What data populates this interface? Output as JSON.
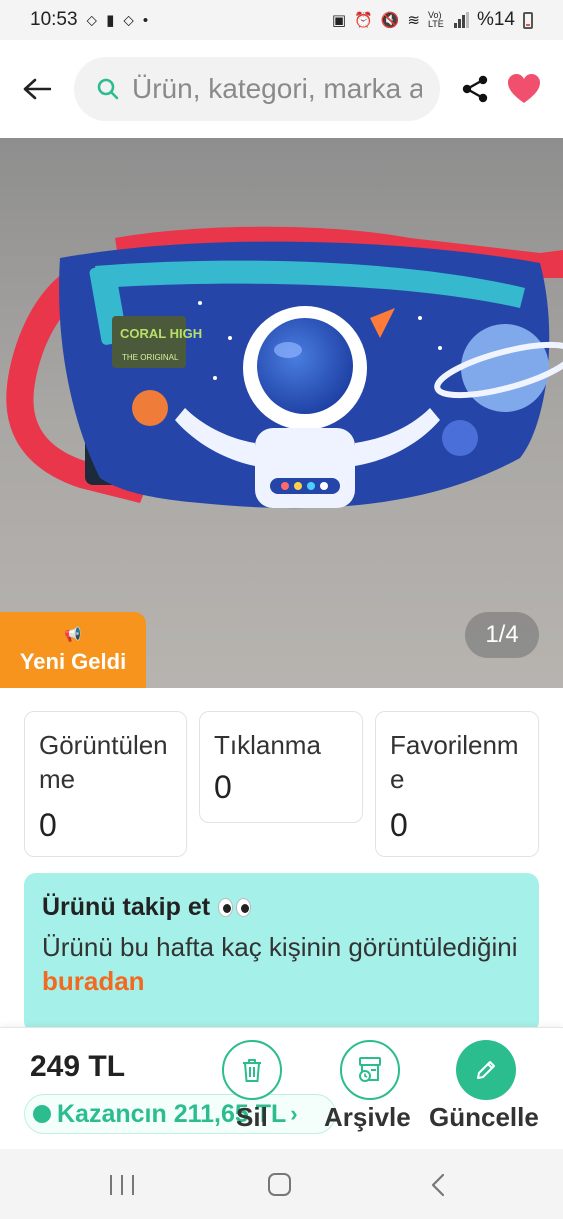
{
  "status_bar": {
    "time": "10:53",
    "battery_text": "%14",
    "network_text": "Vo) LTE"
  },
  "header": {
    "search_placeholder": "Ürün, kategori, marka ara"
  },
  "product": {
    "badge_label": "Yeni Geldi",
    "page_indicator": "1/4",
    "bag_brand_text": "CORAL HIGH",
    "bag_brand_sub": "THE ORIGINAL"
  },
  "stats": [
    {
      "label": "Görüntülenme",
      "value": "0"
    },
    {
      "label": "Tıklanma",
      "value": "0"
    },
    {
      "label": "Favorilenme",
      "value": "0"
    }
  ],
  "follow": {
    "title": "Ürünü takip et",
    "text_before": "Ürünü bu hafta kaç kişinin görüntülediğini ",
    "link": "buradan"
  },
  "bottom": {
    "price": "249 TL",
    "earnings": "Kazancın 211,65 TL",
    "delete_label": "Sil",
    "archive_label": "Arşivle",
    "update_label": "Güncelle"
  },
  "colors": {
    "accent": "#2bbd8e",
    "favorite": "#f0506e",
    "badge": "#f7941d",
    "follow_bg": "#a5f1e9",
    "link": "#f26a21"
  }
}
